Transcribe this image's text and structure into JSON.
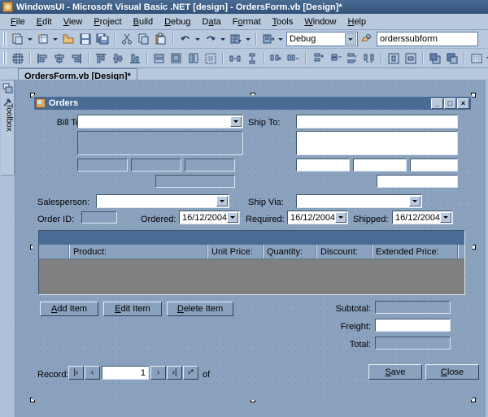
{
  "window": {
    "title": "WindowsUI - Microsoft Visual Basic .NET [design] - OrdersForm.vb [Design]*",
    "icon": "vb-app-icon"
  },
  "menubar": {
    "items": [
      {
        "label": "File",
        "accel": "F"
      },
      {
        "label": "Edit",
        "accel": "E"
      },
      {
        "label": "View",
        "accel": "V"
      },
      {
        "label": "Project",
        "accel": "P"
      },
      {
        "label": "Build",
        "accel": "B"
      },
      {
        "label": "Debug",
        "accel": "D"
      },
      {
        "label": "Data",
        "accel": "a"
      },
      {
        "label": "Format",
        "accel": "o"
      },
      {
        "label": "Tools",
        "accel": "T"
      },
      {
        "label": "Window",
        "accel": "W"
      },
      {
        "label": "Help",
        "accel": "H"
      }
    ]
  },
  "toolbar": {
    "config_value": "Debug",
    "find_value": "orderssubform",
    "icons": [
      "new-project-icon",
      "new-item-icon",
      "open-file-icon",
      "save-icon",
      "save-all-icon",
      "cut-icon",
      "copy-icon",
      "paste-icon",
      "undo-icon",
      "redo-icon",
      "navigate-icon",
      "start-debug-icon",
      "find-icon"
    ],
    "layout_icons": [
      "align-grid-icon",
      "align-left-icon",
      "align-center-icon",
      "align-right-icon",
      "align-top-icon",
      "align-middle-icon",
      "align-bottom-icon",
      "make-same-width-icon",
      "make-same-size-icon",
      "make-same-height-icon",
      "size-to-grid-icon",
      "horizontal-spacing-icon",
      "vertical-spacing-icon",
      "increase-h-spacing-icon",
      "decrease-h-spacing-icon",
      "increase-v-spacing-icon",
      "decrease-v-spacing-icon",
      "center-horizontally-icon",
      "center-vertically-icon",
      "bring-to-front-icon",
      "send-to-back-icon",
      "show-grid-icon"
    ]
  },
  "rail": {
    "label": "Toolbox",
    "icons": [
      "server-explorer-icon",
      "toolbox-hammer-icon"
    ]
  },
  "tabs": [
    {
      "label": "OrdersForm.vb [Design]*",
      "active": true
    }
  ],
  "form": {
    "title": "Orders",
    "window_buttons": [
      {
        "name": "minimize",
        "glyph": "_"
      },
      {
        "name": "maximize",
        "glyph": "□"
      },
      {
        "name": "close",
        "glyph": "×"
      }
    ],
    "labels": {
      "bill_to": "Bill To:",
      "ship_to": "Ship To:",
      "salesperson": "Salesperson:",
      "ship_via": "Ship Via:",
      "order_id": "Order ID:",
      "ordered": "Ordered:",
      "required": "Required:",
      "shipped": "Shipped:",
      "subtotal": "Subtotal:",
      "freight": "Freight:",
      "total": "Total:",
      "record": "Record:",
      "of": "of"
    },
    "values": {
      "bill_to": "",
      "ship_to": "",
      "salesperson": "",
      "ship_via": "",
      "order_id": "",
      "ordered": "16/12/2004",
      "required": "16/12/2004",
      "shipped": "16/12/2004",
      "subtotal": "",
      "freight": "",
      "total": "",
      "record_number": "1",
      "record_count": ""
    },
    "grid": {
      "columns": [
        "Product:",
        "Unit Price:",
        "Quantity:",
        "Discount:",
        "Extended Price:"
      ]
    },
    "buttons": {
      "add_item": "Add Item",
      "edit_item": "Edit Item",
      "delete_item": "Delete Item",
      "save": "Save",
      "close": "Close"
    },
    "nav_buttons": [
      {
        "name": "first-record",
        "glyph": "|‹"
      },
      {
        "name": "previous-record",
        "glyph": "‹"
      },
      {
        "name": "next-record",
        "glyph": "›"
      },
      {
        "name": "last-record",
        "glyph": "›|"
      },
      {
        "name": "new-record",
        "glyph": "›*"
      }
    ]
  },
  "colors": {
    "titlebar": "#33527a",
    "chrome": "#b9c9dd",
    "form_face": "#8ba2bf",
    "grid_body": "#808080",
    "field_white": "#ffffff"
  }
}
